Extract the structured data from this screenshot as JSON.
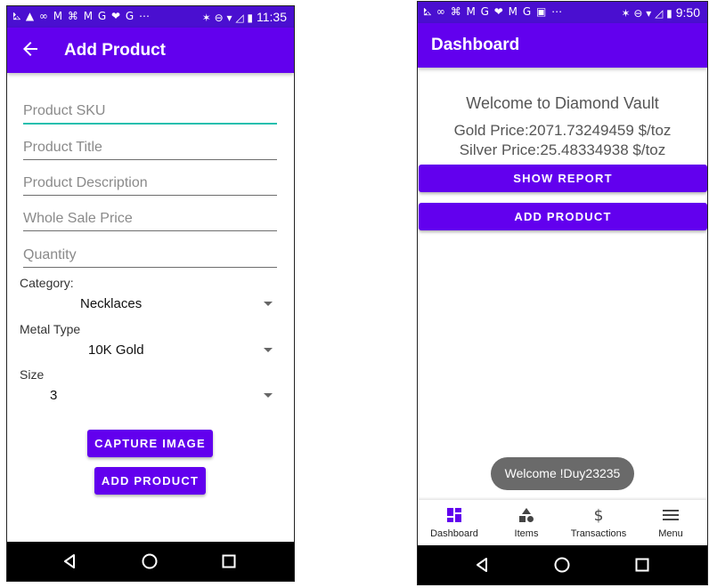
{
  "left_screen": {
    "status_bar": {
      "time": "11:35",
      "left_icons": "⛡ ▲ ∞ M ⌘ M G ❤ G ⋯",
      "right_icons": "✶ ⊖ ▾ ◿ ▮"
    },
    "app_bar": {
      "title": "Add Product",
      "back_icon": "arrow-left"
    },
    "fields": [
      {
        "placeholder": "Product SKU"
      },
      {
        "placeholder": "Product Title"
      },
      {
        "placeholder": "Product Description"
      },
      {
        "placeholder": "Whole Sale Price"
      },
      {
        "placeholder": "Quantity"
      }
    ],
    "category": {
      "label": "Category:",
      "value": "Necklaces"
    },
    "metal_type": {
      "label": "Metal Type",
      "value": "10K Gold"
    },
    "size": {
      "label": "Size",
      "value": "3"
    },
    "buttons": {
      "capture": "CAPTURE IMAGE",
      "add": "ADD PRODUCT"
    }
  },
  "right_screen": {
    "status_bar": {
      "time": "9:50",
      "left_icons": "⛡ ∞ ⌘ M G ❤ M G ▣ ⋯",
      "right_icons": "✶ ⊖ ▾ ◿ ▮"
    },
    "app_bar": {
      "title": "Dashboard"
    },
    "welcome": "Welcome to Diamond Vault",
    "gold_price": "Gold Price:2071.73249459 $/toz",
    "silver_price": "Silver Price:25.48334938 $/toz",
    "buttons": {
      "report": "SHOW REPORT",
      "add": "ADD PRODUCT"
    },
    "toast": "Welcome !Duy23235",
    "bottom_nav": [
      {
        "label": "Dashboard",
        "icon": "dashboard-icon"
      },
      {
        "label": "Items",
        "icon": "shapes-icon"
      },
      {
        "label": "Transactions",
        "icon": "dollar-icon"
      },
      {
        "label": "Menu",
        "icon": "menu-icon"
      }
    ]
  },
  "colors": {
    "primary": "#6200ee",
    "status_bar": "#4a0fd0",
    "focus_underline": "#26bfae",
    "toast": "#6a6a6a",
    "nav_bar": "#000000"
  }
}
